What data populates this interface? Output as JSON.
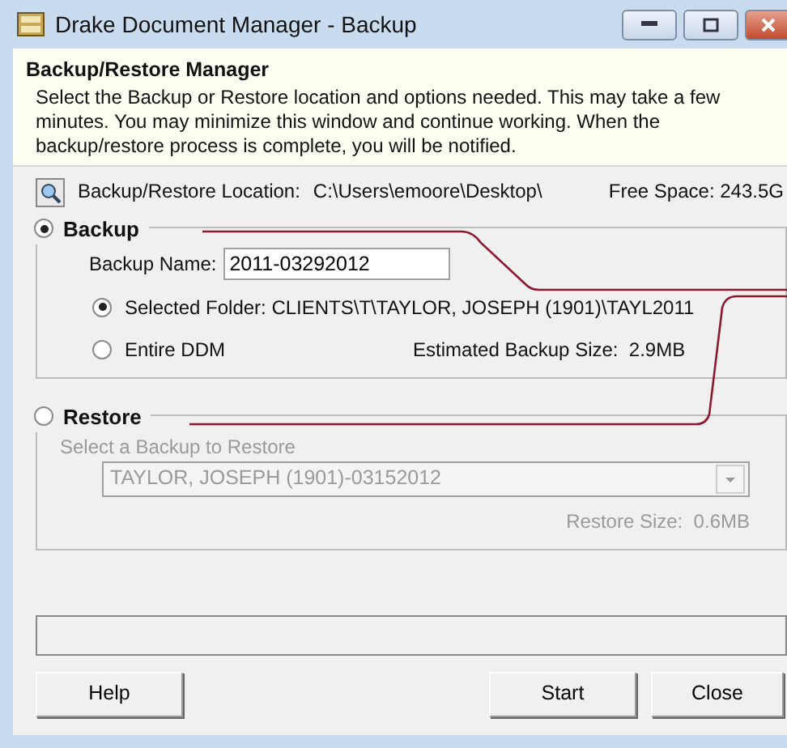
{
  "window": {
    "title": "Drake Document Manager - Backup",
    "controls": [
      {
        "kind": "minimize"
      },
      {
        "kind": "maximize"
      },
      {
        "kind": "close"
      }
    ]
  },
  "header": {
    "title": "Backup/Restore Manager",
    "description": "Select the Backup or Restore location and options needed. This may take a few minutes. You may minimize this window and continue working. When the backup/restore process is complete, you will be notified."
  },
  "location": {
    "label": "Backup/Restore Location:",
    "path": "C:\\Users\\emoore\\Desktop\\",
    "free_space": "Free Space: 243.5G"
  },
  "backup": {
    "label": "Backup",
    "selected": true,
    "name_label": "Backup Name:",
    "name_value": "2011-03292012",
    "options": [
      {
        "label": "Selected Folder: CLIENTS\\T\\TAYLOR, JOSEPH (1901)\\TAYL2011",
        "selected": true
      },
      {
        "label": "Entire DDM",
        "selected": false
      }
    ],
    "estimate": "Estimated Backup Size:  2.9MB"
  },
  "restore": {
    "label": "Restore",
    "selected": false,
    "disabled": true,
    "select_label": "Select a Backup to Restore",
    "select_value": "TAYLOR, JOSEPH (1901)-03152012",
    "size": "Restore Size:  0.6MB"
  },
  "buttons": [
    {
      "label": "Help"
    },
    {
      "label": "Start"
    },
    {
      "label": "Close"
    }
  ]
}
